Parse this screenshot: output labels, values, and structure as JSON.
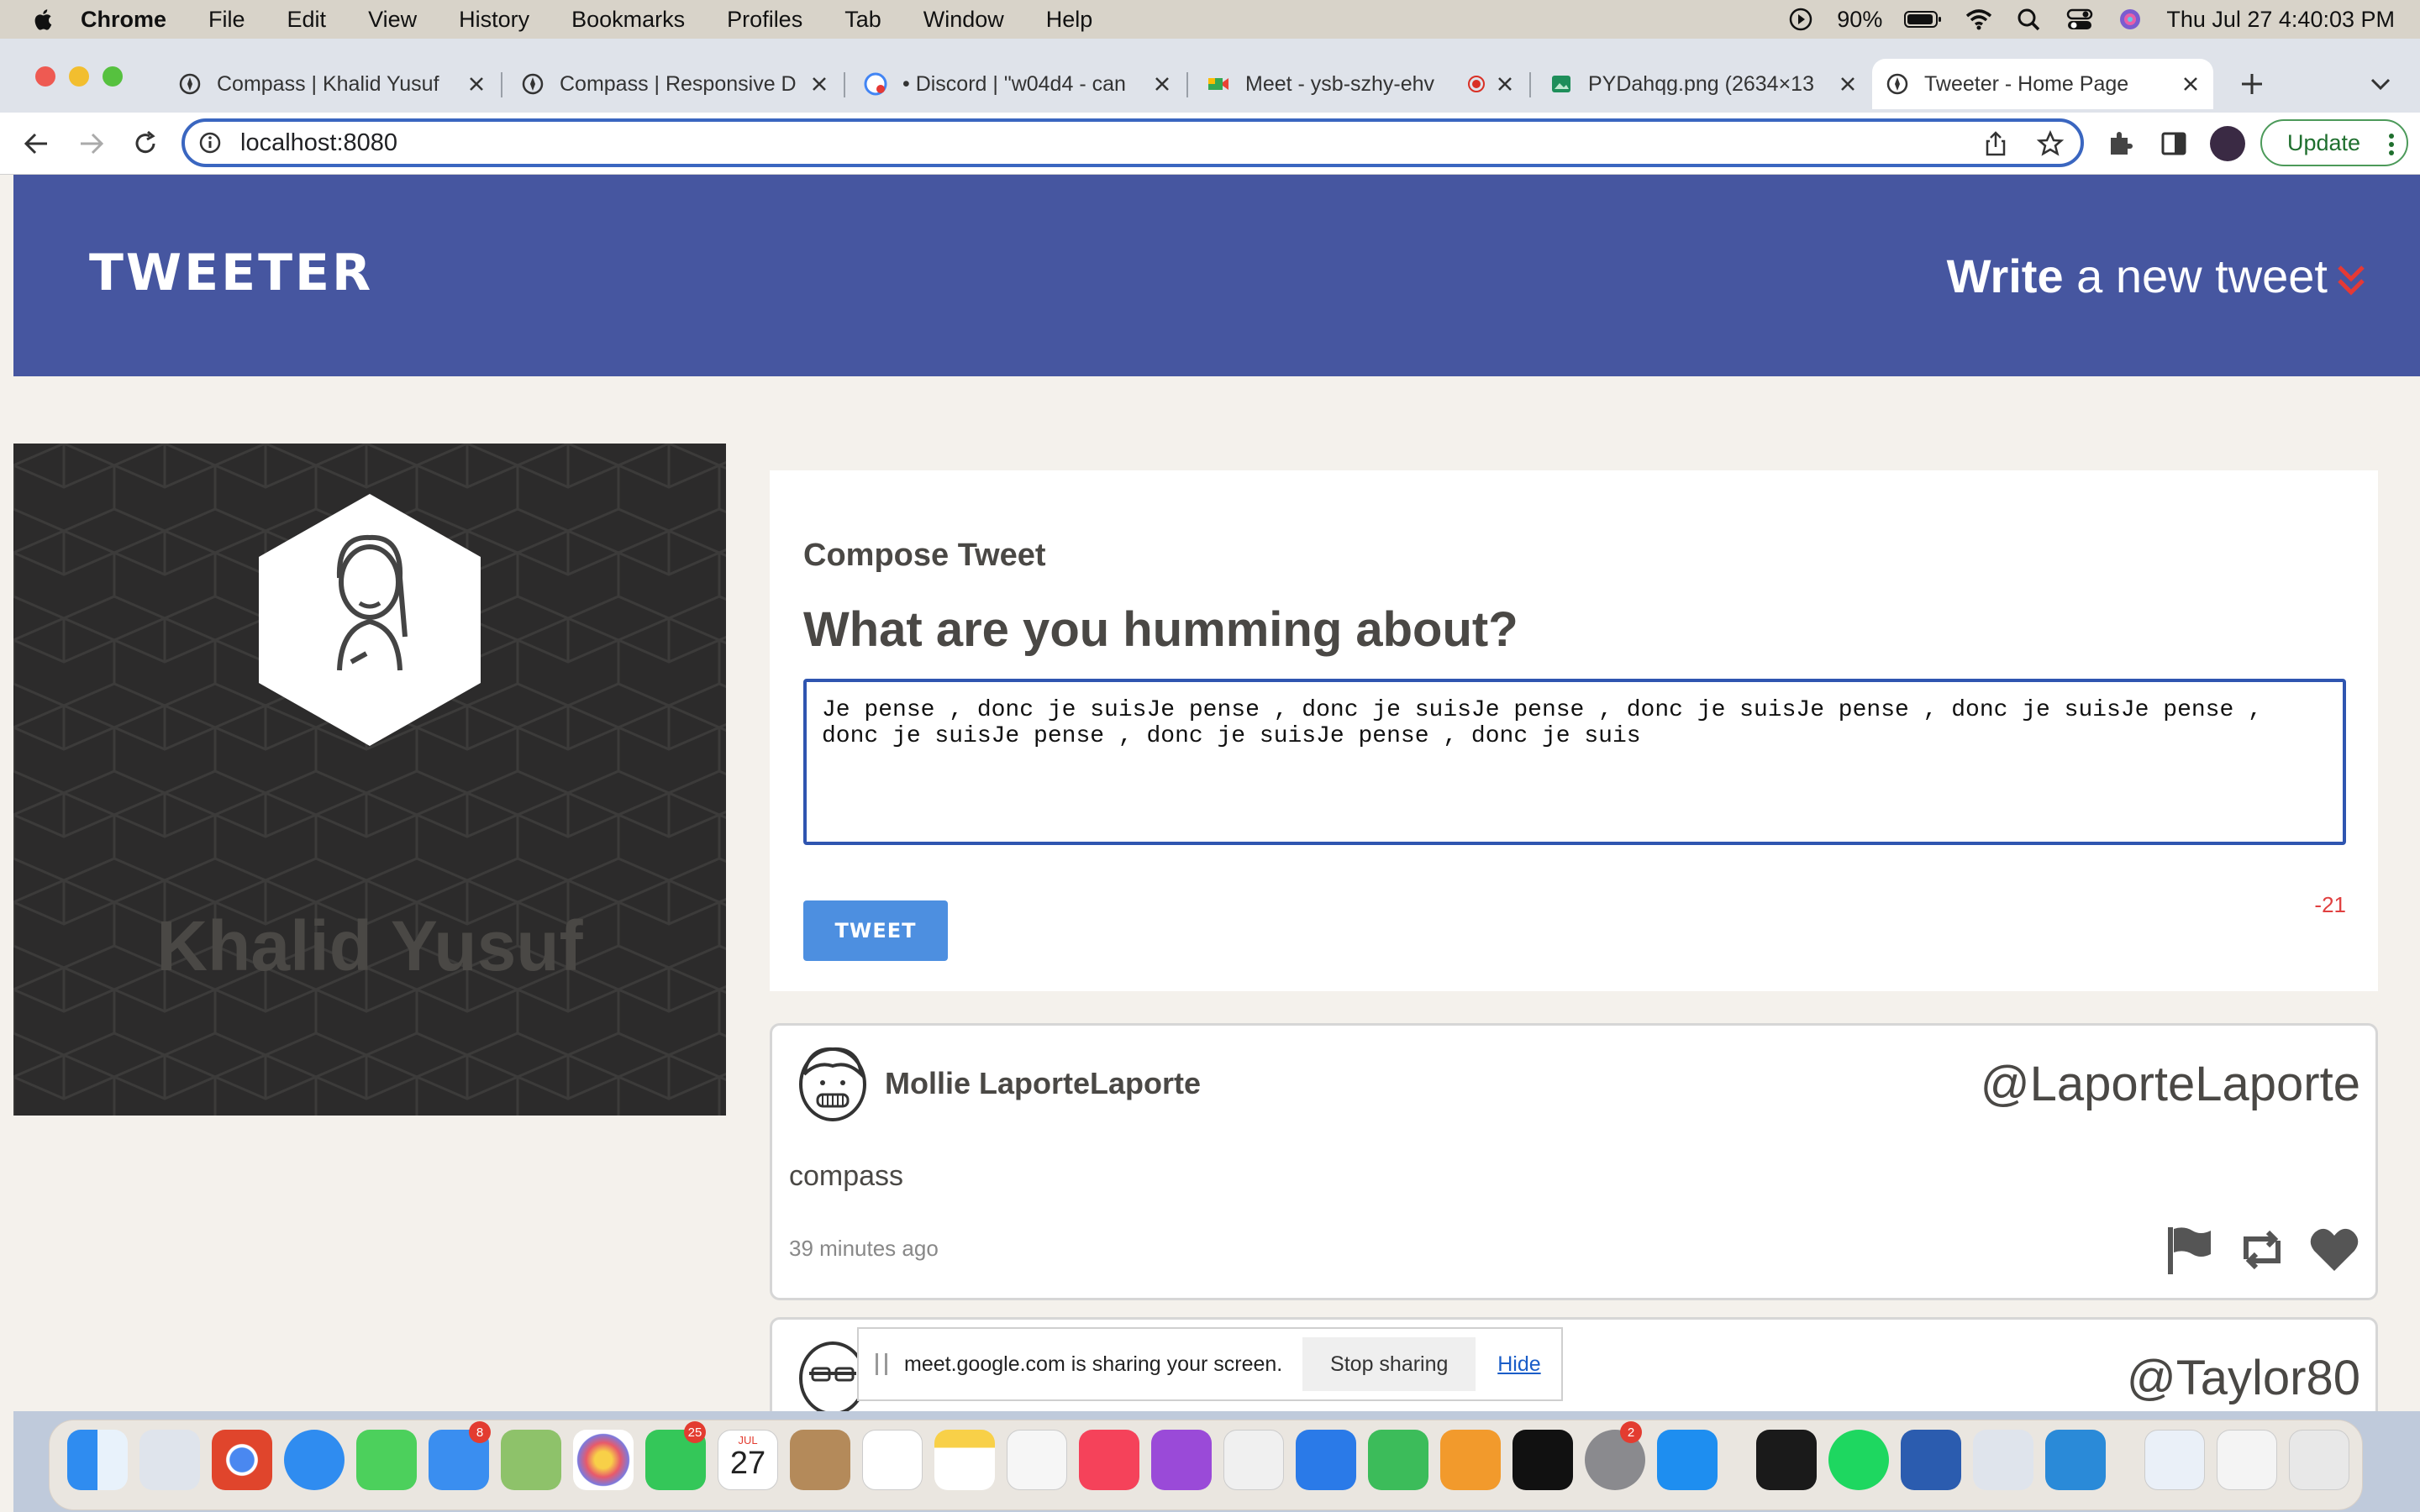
{
  "menubar": {
    "app_name": "Chrome",
    "menus": [
      "File",
      "Edit",
      "View",
      "History",
      "Bookmarks",
      "Profiles",
      "Tab",
      "Window",
      "Help"
    ],
    "battery": "90%",
    "datetime": "Thu Jul 27  4:40:03 PM"
  },
  "tabs": [
    {
      "title": "Compass | Khalid Yusuf",
      "icon": "globe-icon"
    },
    {
      "title": "Compass | Responsive D",
      "icon": "globe-icon"
    },
    {
      "title": "• Discord | \"w04d4 - can",
      "icon": "discord-icon"
    },
    {
      "title": "Meet - ysb-szhy-ehv",
      "icon": "meet-icon"
    },
    {
      "title": "PYDahqg.png (2634×13",
      "icon": "image-icon"
    },
    {
      "title": "Tweeter - Home Page",
      "icon": "globe-icon",
      "active": true
    }
  ],
  "address_bar": {
    "url": "localhost:8080",
    "update_label": "Update"
  },
  "app": {
    "brand": "TWEETER",
    "write_bold": "Write",
    "write_rest": " a new tweet",
    "accent_color": "#e53935",
    "nav_color": "#4656a0"
  },
  "profile": {
    "name": "Khalid Yusuf"
  },
  "compose": {
    "label": "Compose Tweet",
    "question": "What are you humming about?",
    "text": "Je pense , donc je suisJe pense , donc je suisJe pense , donc je suisJe pense , donc je suisJe pense , donc je suisJe pense , donc je suisJe pense , donc je suis",
    "button": "TWEET",
    "counter": "-21"
  },
  "tweets": [
    {
      "name": "Mollie LaporteLaporte",
      "handle": "@LaporteLaporte",
      "content": "compass",
      "time": "39 minutes ago"
    },
    {
      "name": "",
      "handle": "@Taylor80",
      "content": "",
      "time": ""
    }
  ],
  "screen_share": {
    "message": "meet.google.com is sharing your screen.",
    "stop": "Stop sharing",
    "hide": "Hide"
  },
  "dock": {
    "calendar_month": "JUL",
    "calendar_day": "27",
    "mail_badge": "8",
    "facetime_badge": "25",
    "settings_badge": "2"
  }
}
